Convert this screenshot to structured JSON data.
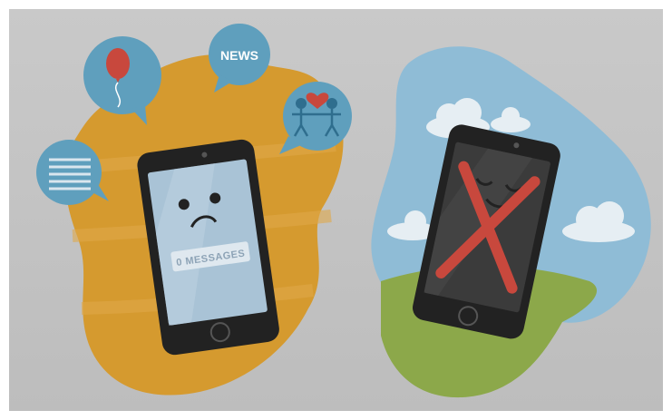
{
  "illustration": {
    "news_label": "NEWS",
    "messages_label": "0 MESSAGES"
  },
  "colors": {
    "background": "#c4c4c4",
    "orange_blob": "#d79a2e",
    "sky_blob": "#8fbcd6",
    "grass": "#8ca84a",
    "bubble": "#5f9fbd",
    "phone_body": "#222222",
    "phone_screen": "#a9c3d6",
    "dark_screen": "#3b3b3b",
    "red_x": "#c8483d",
    "heart": "#c8483d"
  }
}
